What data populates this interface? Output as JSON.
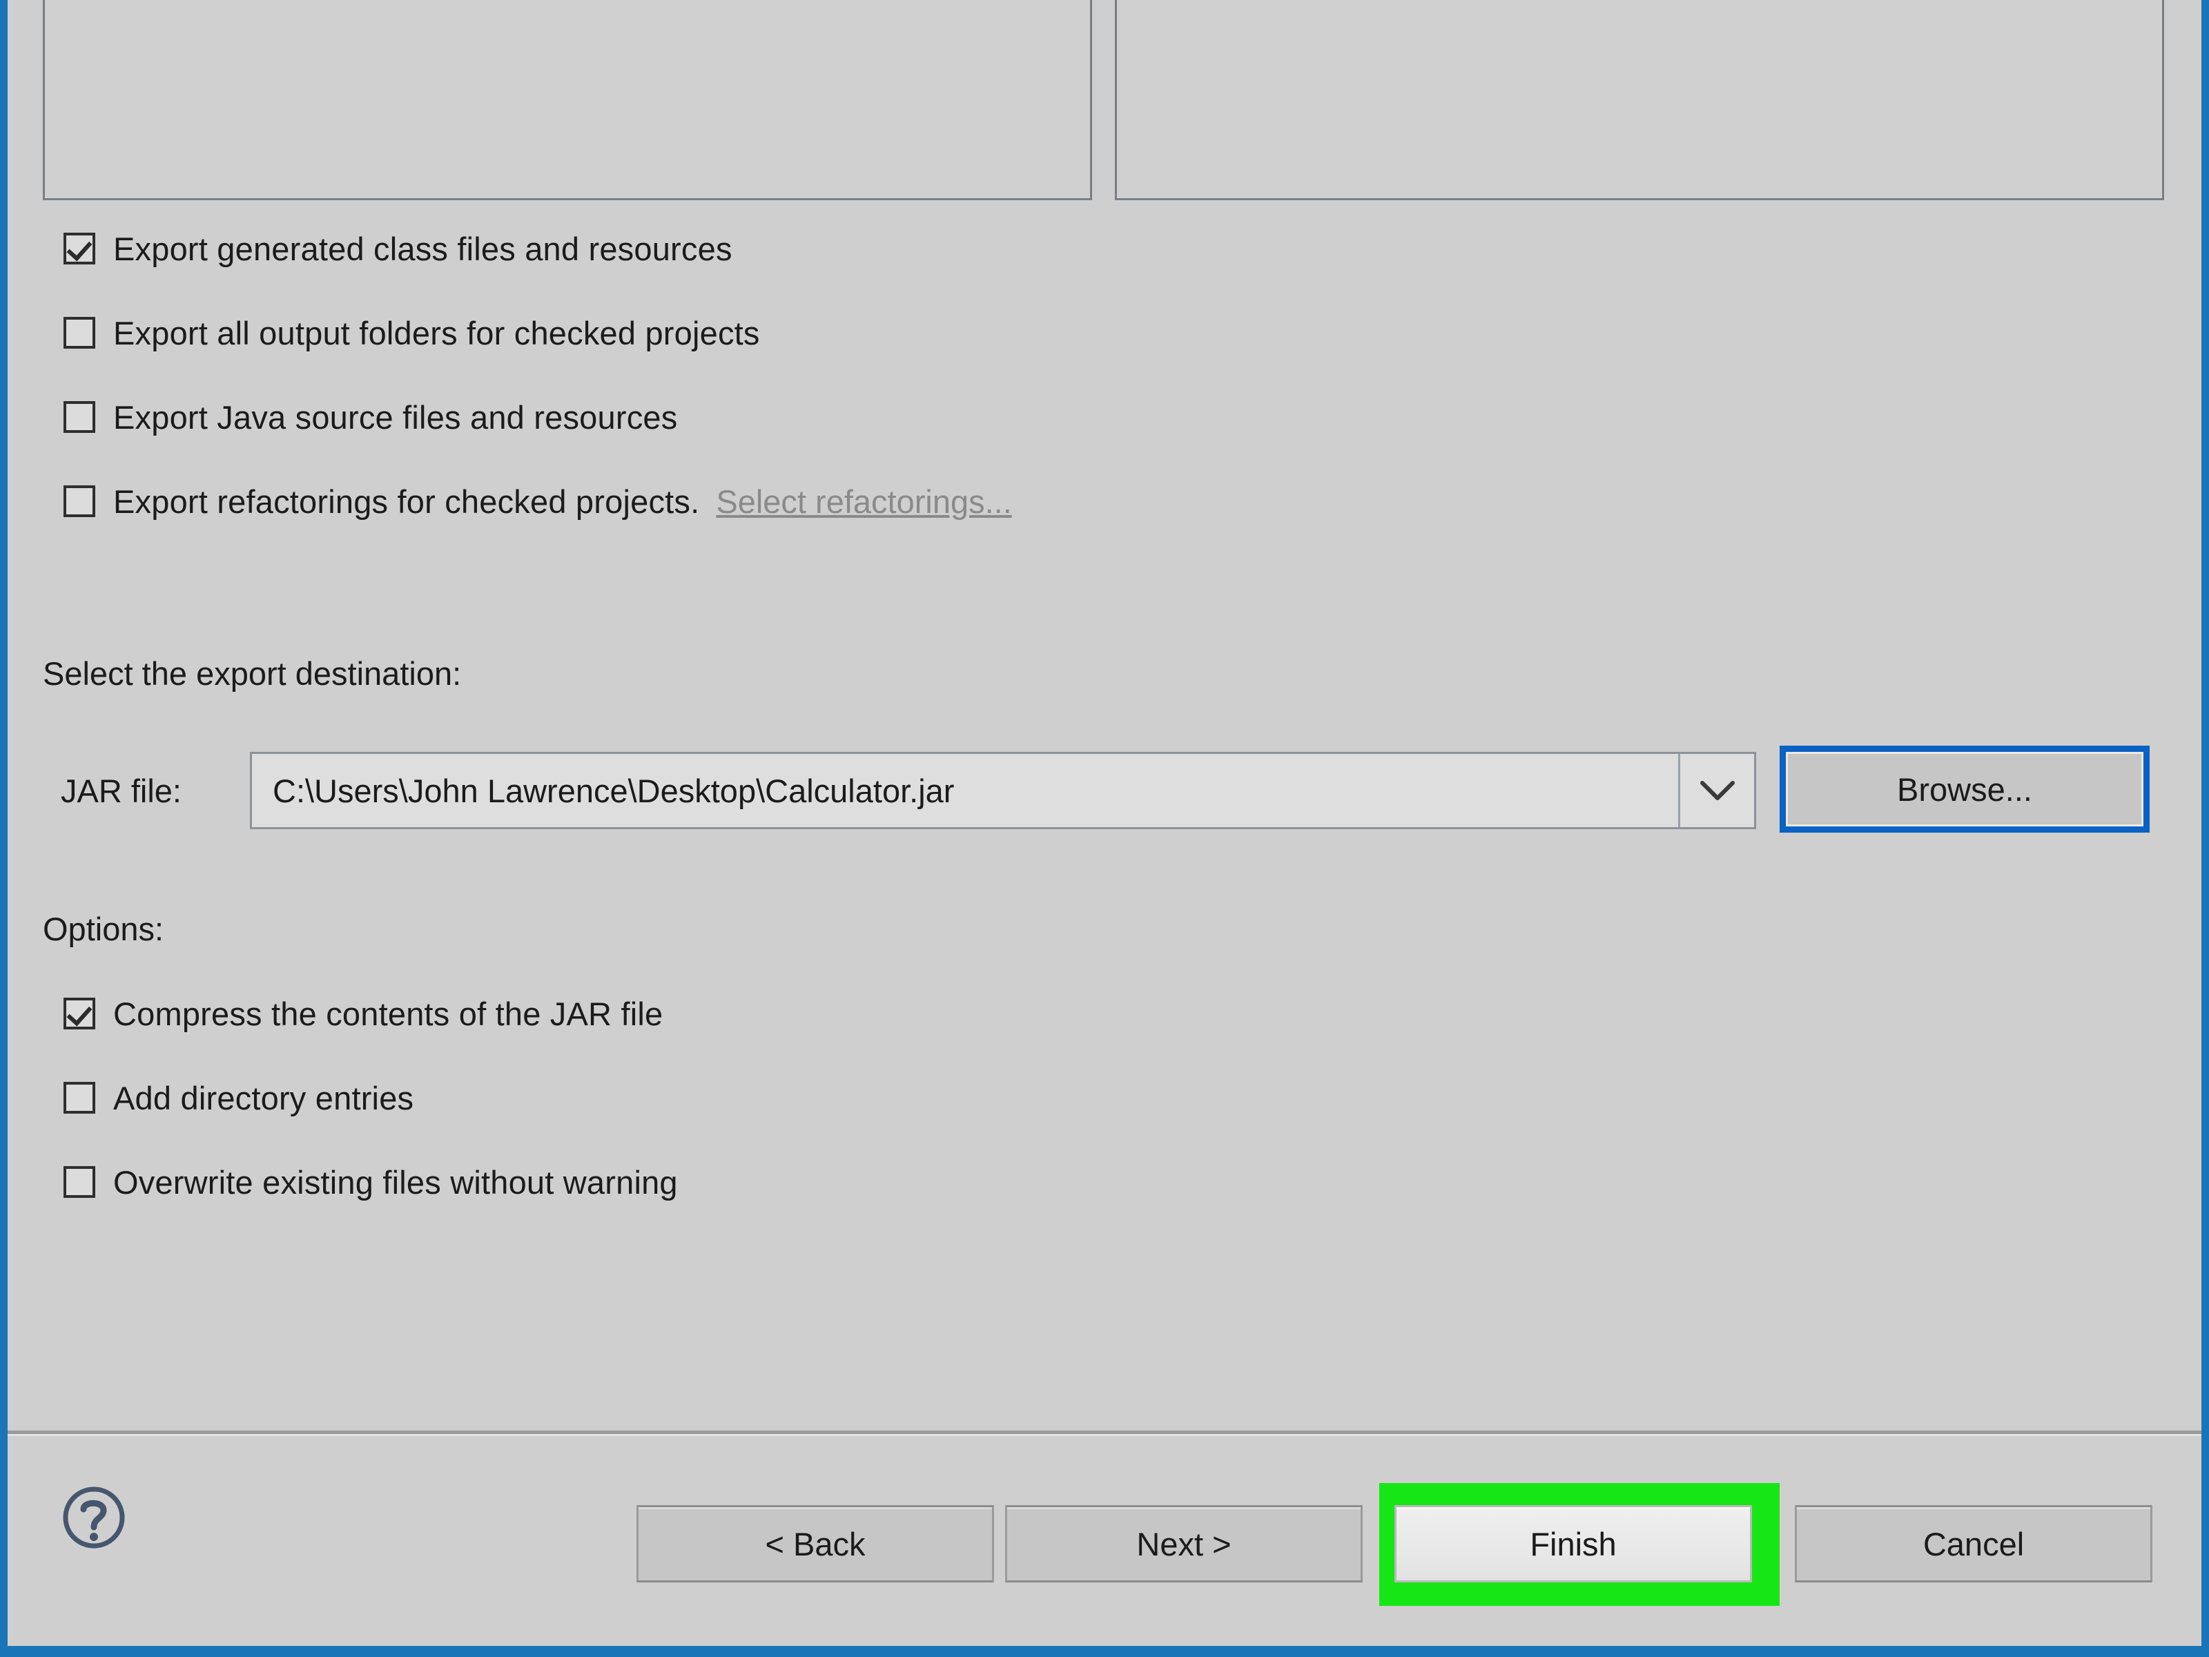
{
  "dialog": {
    "accent_blue": "#1a74b8",
    "surface_color": "#cfcfcf",
    "highlight_color": "#16e616",
    "focus_border_color": "#0a62c4"
  },
  "panels": {
    "left_list_label": "",
    "right_list_label": ""
  },
  "export_options": {
    "items": [
      {
        "label": "Export generated class files and resources",
        "checked": true
      },
      {
        "label": "Export all output folders for checked projects",
        "checked": false
      },
      {
        "label": "Export Java source files and resources",
        "checked": false
      },
      {
        "label": "Export refactorings for checked projects.",
        "checked": false,
        "link": "Select refactorings..."
      }
    ]
  },
  "destination": {
    "heading": "Select the export destination:",
    "jar_label": "JAR file:",
    "jar_value": "C:\\Users\\John Lawrence\\Desktop\\Calculator.jar",
    "dropdown_icon": "chevron-down-icon",
    "browse_label": "Browse..."
  },
  "options": {
    "heading": "Options:",
    "items": [
      {
        "label": "Compress the contents of the JAR file",
        "checked": true
      },
      {
        "label": "Add directory entries",
        "checked": false
      },
      {
        "label": "Overwrite existing files without warning",
        "checked": false
      }
    ]
  },
  "footer": {
    "help_icon": "question-mark-circle-icon",
    "back_label": "< Back",
    "next_label": "Next >",
    "finish_label": "Finish",
    "cancel_label": "Cancel"
  }
}
